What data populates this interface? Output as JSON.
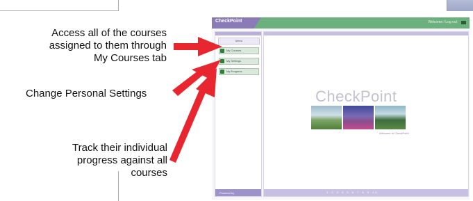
{
  "annotations": {
    "courses": [
      "Access all of the courses",
      "assigned to them through",
      "My Courses tab"
    ],
    "settings": "Change Personal Settings",
    "progress": [
      "Track their individual",
      "progress against all",
      "courses"
    ]
  },
  "app": {
    "logo": "CheckPoint",
    "header_right": "Welcome / Log out",
    "sidebar_title": "Menu",
    "menu": [
      "My Courses",
      "My Settings",
      "My Progress"
    ],
    "sidebar_footer": "Powered by",
    "main_title": "CheckPoint",
    "caption": "Welcome to CheckPoint",
    "footer": "1 2 3 4 5 6 7 8 9 10"
  },
  "colors": {
    "arrow": "#e8262f",
    "header_green": "#6bb07d",
    "brand_purple": "#8a7ab8"
  }
}
